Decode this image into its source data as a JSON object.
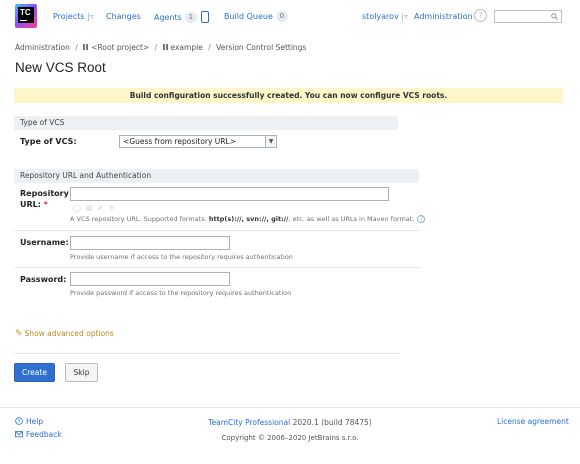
{
  "logo": {
    "letters": "TC"
  },
  "topbar": {
    "projects": "Projects",
    "projects_caret": "|▿",
    "changes": "Changes",
    "agents": "Agents",
    "agents_count": "1",
    "build_queue": "Build Queue",
    "build_queue_count": "0",
    "user": "stolyarov",
    "user_caret": "|▿",
    "administration": "Administration",
    "help_glyph": "?"
  },
  "breadcrumb": {
    "items": [
      "Administration",
      "<Root project>",
      "example",
      "Version Control Settings"
    ],
    "separator": "/"
  },
  "page_title": "New VCS Root",
  "success_message": "Build configuration successfully created. You can now configure VCS roots.",
  "type_section": {
    "heading": "Type of VCS",
    "label": "Type of VCS:",
    "selected": "<Guess from repository URL>"
  },
  "repo_section": {
    "heading": "Repository URL and Authentication",
    "repo_label_line1": "Repository",
    "repo_label_line2": "URL:",
    "repo_required": "*",
    "repo_value": "",
    "repo_hint_prefix": "A VCS repository URL. Supported formats:",
    "repo_hint_formats": "http(s)://, svn://, git://",
    "repo_hint_suffix": ", etc. as well as URLs in Maven format.",
    "username_label": "Username:",
    "username_value": "",
    "username_hint": "Provide username if access to the repository requires authentication",
    "password_label": "Password:",
    "password_value": "",
    "password_hint": "Provide password if access to the repository requires authentication"
  },
  "advanced": {
    "label": "Show advanced options"
  },
  "buttons": {
    "create": "Create",
    "skip": "Skip"
  },
  "footer": {
    "help": "Help",
    "feedback": "Feedback",
    "product": "TeamCity Professional",
    "version": "2020.1 (build 78475)",
    "license": "License agreement",
    "copyright": "Copyright © 2006–2020 JetBrains s.r.o."
  },
  "colors": {
    "link": "#2a6fd3",
    "primary_button": "#2f6fcf",
    "success_bg": "#fdf6c8",
    "advanced_link": "#c08a1f"
  }
}
